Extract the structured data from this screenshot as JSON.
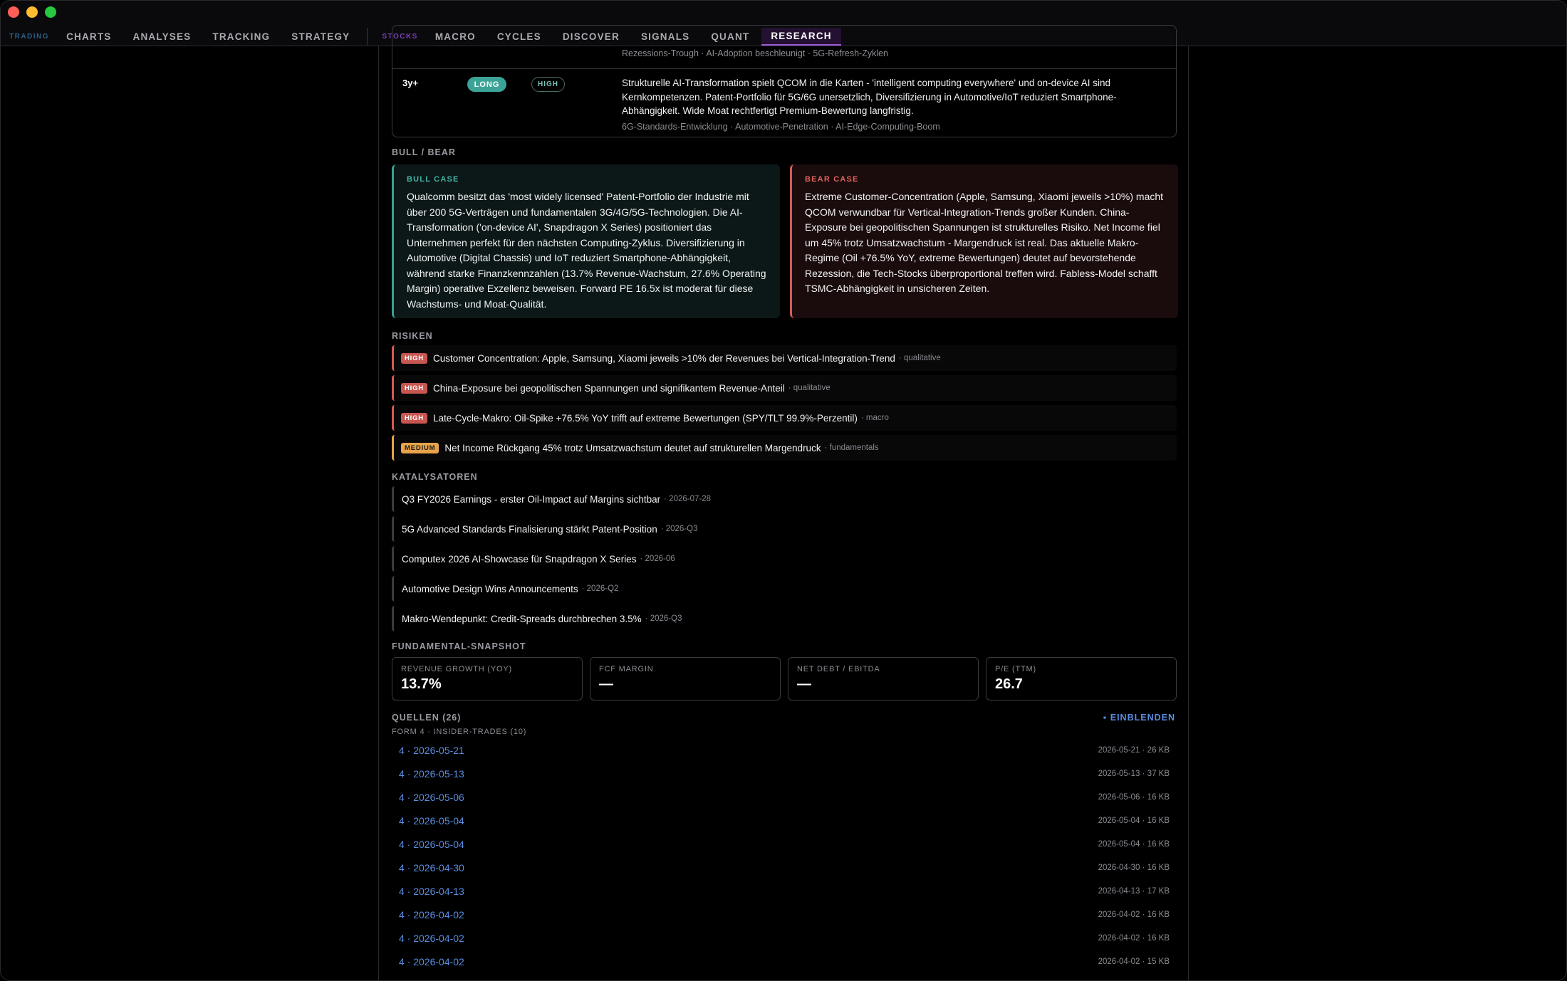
{
  "nav": {
    "trading_label": "TRADING",
    "stocks_label": "STOCKS",
    "trading_items": [
      "CHARTS",
      "ANALYSES",
      "TRACKING",
      "STRATEGY"
    ],
    "stocks_items": [
      "MACRO",
      "CYCLES",
      "DISCOVER",
      "SIGNALS",
      "QUANT",
      "RESEARCH"
    ],
    "active": "RESEARCH"
  },
  "horizon": {
    "prev_drivers": "Rezessions-Trough · AI-Adoption beschleunigt · 5G-Refresh-Zyklen",
    "term": "3y+",
    "direction": "LONG",
    "conviction": "HIGH",
    "description": "Strukturelle AI-Transformation spielt QCOM in die Karten - 'intelligent computing everywhere' und on-device AI sind Kernkompetenzen. Patent-Portfolio für 5G/6G unersetzlich, Diversifizierung in Automotive/IoT reduziert Smartphone-Abhängigkeit. Wide Moat rechtfertigt Premium-Bewertung langfristig.",
    "drivers": "6G-Standards-Entwicklung · Automotive-Penetration · AI-Edge-Computing-Boom"
  },
  "bullbear": {
    "heading": "BULL / BEAR",
    "bull_label": "BULL CASE",
    "bull_text": "Qualcomm besitzt das 'most widely licensed' Patent-Portfolio der Industrie mit über 200 5G-Verträgen und fundamentalen 3G/4G/5G-Technologien. Die AI-Transformation ('on-device AI', Snapdragon X Series) positioniert das Unternehmen perfekt für den nächsten Computing-Zyklus. Diversifizierung in Automotive (Digital Chassis) und IoT reduziert Smartphone-Abhängigkeit, während starke Finanzkennzahlen (13.7% Revenue-Wachstum, 27.6% Operating Margin) operative Exzellenz beweisen. Forward PE 16.5x ist moderat für diese Wachstums- und Moat-Qualität.",
    "bear_label": "BEAR CASE",
    "bear_text": "Extreme Customer-Concentration (Apple, Samsung, Xiaomi jeweils >10%) macht QCOM verwundbar für Vertical-Integration-Trends großer Kunden. China-Exposure bei geopolitischen Spannungen ist strukturelles Risiko. Net Income fiel um 45% trotz Umsatzwachstum - Margendruck ist real. Das aktuelle Makro-Regime (Oil +76.5% YoY, extreme Bewertungen) deutet auf bevorstehende Rezession, die Tech-Stocks überproportional treffen wird. Fabless-Model schafft TSMC-Abhängigkeit in unsicheren Zeiten."
  },
  "risks": {
    "heading": "RISIKEN",
    "items": [
      {
        "level": "HIGH",
        "text": "Customer Concentration: Apple, Samsung, Xiaomi jeweils >10% der Revenues bei Vertical-Integration-Trend",
        "type": "· qualitative"
      },
      {
        "level": "HIGH",
        "text": "China-Exposure bei geopolitischen Spannungen und signifikantem Revenue-Anteil",
        "type": "· qualitative"
      },
      {
        "level": "HIGH",
        "text": "Late-Cycle-Makro: Oil-Spike +76.5% YoY trifft auf extreme Bewertungen (SPY/TLT 99.9%-Perzentil)",
        "type": "· macro"
      },
      {
        "level": "MEDIUM",
        "text": "Net Income Rückgang 45% trotz Umsatzwachstum deutet auf strukturellen Margendruck",
        "type": "· fundamentals"
      }
    ]
  },
  "catalysts": {
    "heading": "KATALYSATOREN",
    "items": [
      {
        "text": "Q3 FY2026 Earnings - erster Oil-Impact auf Margins sichtbar",
        "date": "· 2026-07-28"
      },
      {
        "text": "5G Advanced Standards Finalisierung stärkt Patent-Position",
        "date": "· 2026-Q3"
      },
      {
        "text": "Computex 2026 AI-Showcase für Snapdragon X Series",
        "date": "· 2026-06"
      },
      {
        "text": "Automotive Design Wins Announcements",
        "date": "· 2026-Q2"
      },
      {
        "text": "Makro-Wendepunkt: Credit-Spreads durchbrechen 3.5%",
        "date": "· 2026-Q3"
      }
    ]
  },
  "fundamentals": {
    "heading": "FUNDAMENTAL-SNAPSHOT",
    "cards": [
      {
        "label": "REVENUE GROWTH (YOY)",
        "value": "13.7%"
      },
      {
        "label": "FCF MARGIN",
        "value": "—"
      },
      {
        "label": "NET DEBT / EBITDA",
        "value": "—"
      },
      {
        "label": "P/E (TTM)",
        "value": "26.7"
      }
    ]
  },
  "sources": {
    "heading": "QUELLEN (26)",
    "toggle": "▪ EINBLENDEN",
    "group": "FORM 4 · INSIDER-TRADES (10)",
    "rows": [
      {
        "link": "4 · 2026-05-21",
        "info": "2026-05-21 · 26 KB"
      },
      {
        "link": "4 · 2026-05-13",
        "info": "2026-05-13 · 37 KB"
      },
      {
        "link": "4 · 2026-05-06",
        "info": "2026-05-06 · 16 KB"
      },
      {
        "link": "4 · 2026-05-04",
        "info": "2026-05-04 · 16 KB"
      },
      {
        "link": "4 · 2026-05-04",
        "info": "2026-05-04 · 16 KB"
      },
      {
        "link": "4 · 2026-04-30",
        "info": "2026-04-30 · 16 KB"
      },
      {
        "link": "4 · 2026-04-13",
        "info": "2026-04-13 · 17 KB"
      },
      {
        "link": "4 · 2026-04-02",
        "info": "2026-04-02 · 16 KB"
      },
      {
        "link": "4 · 2026-04-02",
        "info": "2026-04-02 · 16 KB"
      },
      {
        "link": "4 · 2026-04-02",
        "info": "2026-04-02 · 15 KB"
      }
    ]
  },
  "colors": {
    "accent": "#9b59d6",
    "bull": "#3c9f94",
    "bear": "#d65a55",
    "medium": "#e8a34b",
    "link": "#5a8de0"
  }
}
